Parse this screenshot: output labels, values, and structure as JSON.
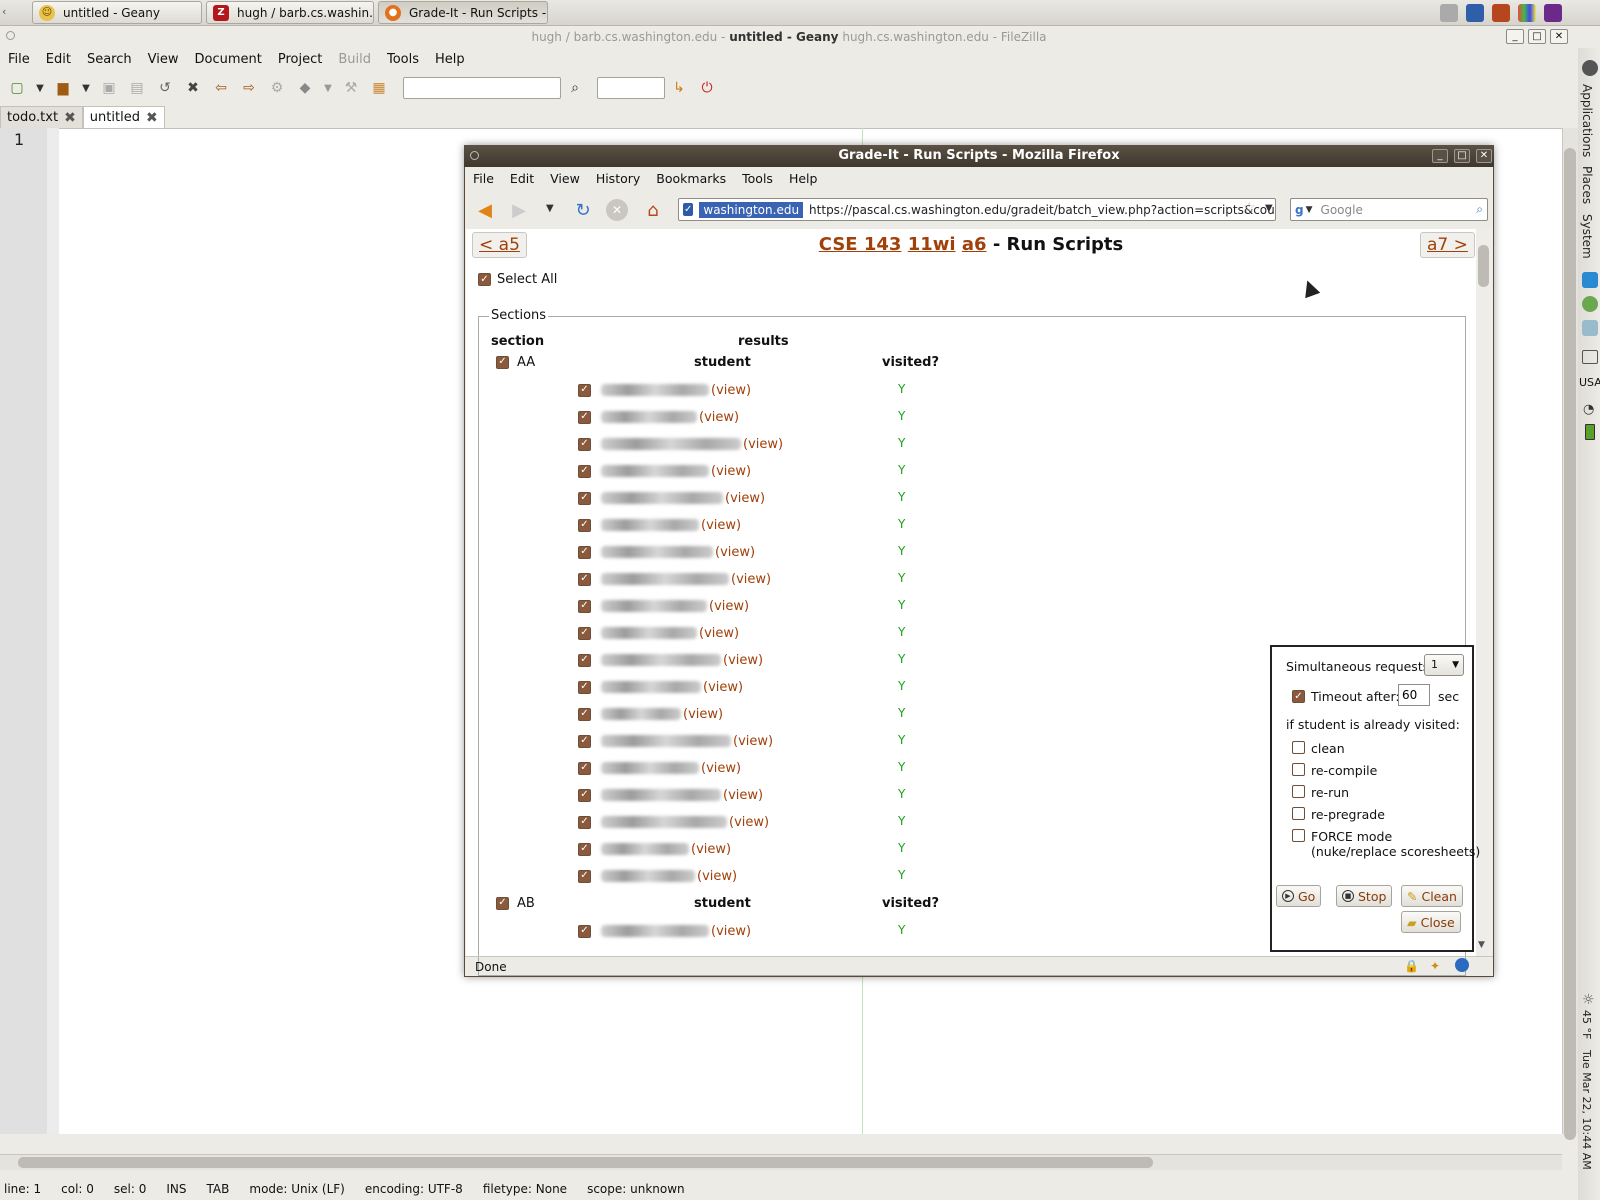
{
  "taskbar": {
    "items": [
      {
        "label": "untitled - Geany",
        "active": false
      },
      {
        "label": "hugh / barb.cs.washin...",
        "active": false
      },
      {
        "label": "Grade-It - Run Scripts -...",
        "active": true
      }
    ]
  },
  "geany": {
    "title_prefix": "hugh / barb.cs.washington.edu -",
    "title_main": "untitled - Geany",
    "title_suffix": "hugh.cs.washington.edu - FileZilla",
    "menu": [
      "File",
      "Edit",
      "Search",
      "View",
      "Document",
      "Project",
      "Build",
      "Tools",
      "Help"
    ],
    "tabs": [
      {
        "label": "todo.txt"
      },
      {
        "label": "untitled"
      }
    ],
    "line_number": "1",
    "status": {
      "line": "line: 1",
      "col": "col: 0",
      "sel": "sel: 0",
      "ins": "INS",
      "tab": "TAB",
      "mode": "mode: Unix (LF)",
      "encoding": "encoding: UTF-8",
      "filetype": "filetype: None",
      "scope": "scope: unknown"
    }
  },
  "side_panel": {
    "labels": [
      "Applications",
      "Places",
      "System",
      "USA"
    ],
    "clock": "Tue Mar 22, 10:44 AM",
    "weather": "45 °F"
  },
  "firefox": {
    "title": "Grade-It - Run Scripts - Mozilla Firefox",
    "menu": [
      "File",
      "Edit",
      "View",
      "History",
      "Bookmarks",
      "Tools",
      "Help"
    ],
    "url_site": "washington.edu",
    "url": "https://pascal.cs.washington.edu/gradeit/batch_view.php?action=scripts&course",
    "search_placeholder": "Google",
    "status": "Done"
  },
  "page": {
    "prev_link": "< a5",
    "next_link": "a7 >",
    "title_course": "CSE 143",
    "title_quarter": "11wi",
    "title_assignment": "a6",
    "title_rest": "- Run Scripts",
    "select_all": "Select All",
    "legend": "Sections",
    "col_section": "section",
    "col_results": "results",
    "col_student": "student",
    "col_visited": "visited?",
    "view_label": "(view)",
    "sections": [
      {
        "name": "AA",
        "students": [
          {
            "visited": "Y"
          },
          {
            "visited": "Y"
          },
          {
            "visited": "Y"
          },
          {
            "visited": "Y"
          },
          {
            "visited": "Y"
          },
          {
            "visited": "Y"
          },
          {
            "visited": "Y"
          },
          {
            "visited": "Y"
          },
          {
            "visited": "Y"
          },
          {
            "visited": "Y"
          },
          {
            "visited": "Y"
          },
          {
            "visited": "Y"
          },
          {
            "visited": "Y"
          },
          {
            "visited": "Y"
          },
          {
            "visited": "Y"
          },
          {
            "visited": "Y"
          },
          {
            "visited": "Y"
          },
          {
            "visited": "Y"
          },
          {
            "visited": "Y"
          }
        ]
      },
      {
        "name": "AB",
        "students": [
          {
            "visited": "Y"
          }
        ]
      }
    ]
  },
  "options": {
    "simultaneous_label": "Simultaneous requests:",
    "simultaneous_value": "1",
    "timeout_label": "Timeout after:",
    "timeout_value": "60",
    "timeout_unit": "sec",
    "if_visited_label": "if student is already visited:",
    "checks": [
      "clean",
      "re-compile",
      "re-run",
      "re-pregrade"
    ],
    "force_line1": "FORCE mode",
    "force_line2": "(nuke/replace scoresheets)",
    "buttons": {
      "go": "Go",
      "stop": "Stop",
      "clean": "Clean",
      "close": "Close"
    }
  }
}
